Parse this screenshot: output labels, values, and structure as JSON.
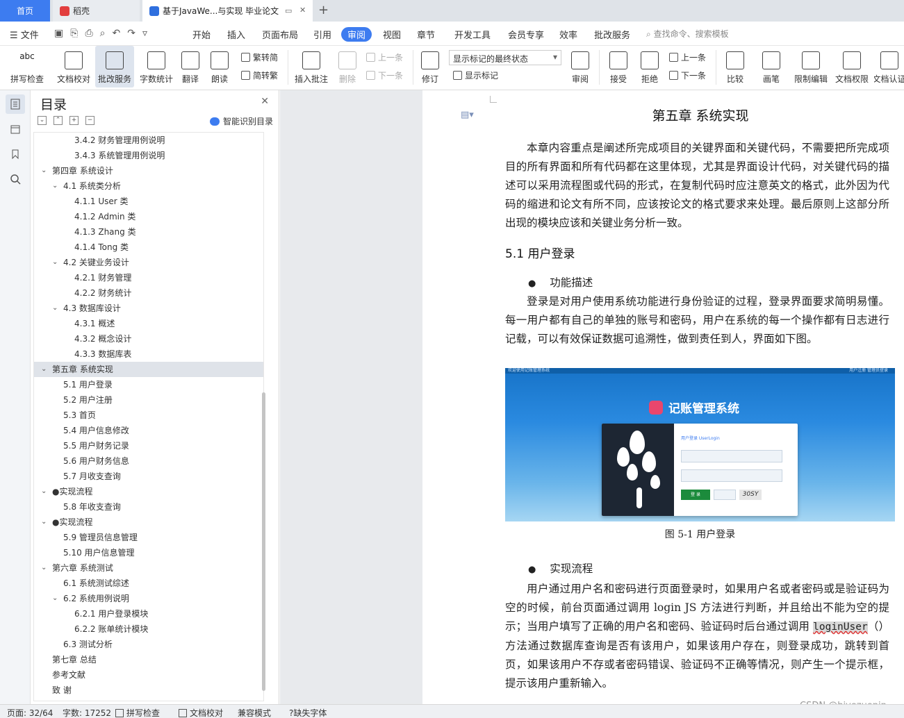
{
  "tabs": [
    {
      "label": "首页"
    },
    {
      "label": "稻壳"
    },
    {
      "label": "基于JavaWe...与实现 毕业论文"
    }
  ],
  "menu": {
    "file": "文件",
    "items": [
      "开始",
      "插入",
      "页面布局",
      "引用",
      "审阅",
      "视图",
      "章节",
      "开发工具",
      "会员专享",
      "效率",
      "批改服务"
    ],
    "active": "审阅",
    "search_placeholder": "查找命令、搜索模板"
  },
  "ribbon": {
    "spellcheck": "拼写检查",
    "doc_proof": "文档校对",
    "review_service": "批改服务",
    "word_count": "字数统计",
    "translate": "翻译",
    "read_aloud": "朗读",
    "trad_to_simp": "繁转简",
    "simp_to_trad": "简转繁",
    "insert_comment": "插入批注",
    "delete": "删除",
    "prev_comment": "上一条",
    "next_comment": "下一条",
    "track_changes": "修订",
    "markup_select": "显示标记的最终状态",
    "show_markup": "显示标记",
    "review_pane": "审阅",
    "accept": "接受",
    "reject": "拒绝",
    "prev_change": "上一条",
    "next_change": "下一条",
    "compare": "比较",
    "ink": "画笔",
    "restrict_edit": "限制编辑",
    "doc_permission": "文档权限",
    "doc_cert": "文档认证"
  },
  "toc": {
    "title": "目录",
    "smart_button": "智能识别目录",
    "items": [
      {
        "label": "3.4.2 财务管理用例说明",
        "level": 3,
        "caret": false
      },
      {
        "label": "3.4.3 系统管理用例说明",
        "level": 3,
        "caret": false
      },
      {
        "label": "第四章    系统设计",
        "level": 1,
        "caret": true
      },
      {
        "label": "4.1 系统类分析",
        "level": 2,
        "caret": true
      },
      {
        "label": "4.1.1 User 类",
        "level": 3,
        "caret": false
      },
      {
        "label": "4.1.2 Admin 类",
        "level": 3,
        "caret": false
      },
      {
        "label": "4.1.3 Zhang 类",
        "level": 3,
        "caret": false
      },
      {
        "label": "4.1.4 Tong 类",
        "level": 3,
        "caret": false
      },
      {
        "label": "4.2 关键业务设计",
        "level": 2,
        "caret": true
      },
      {
        "label": "4.2.1  财务管理",
        "level": 3,
        "caret": false
      },
      {
        "label": "4.2.2  财务统计",
        "level": 3,
        "caret": false
      },
      {
        "label": "4.3 数据库设计",
        "level": 2,
        "caret": true
      },
      {
        "label": "4.3.1 概述",
        "level": 3,
        "caret": false
      },
      {
        "label": "4.3.2 概念设计",
        "level": 3,
        "caret": false
      },
      {
        "label": "4.3.3 数据库表",
        "level": 3,
        "caret": false
      },
      {
        "label": "第五章  系统实现",
        "level": 1,
        "caret": true,
        "selected": true
      },
      {
        "label": "5.1 用户登录",
        "level": 2,
        "caret": false
      },
      {
        "label": "5.2  用户注册",
        "level": 2,
        "caret": false
      },
      {
        "label": "5.3  首页",
        "level": 2,
        "caret": false
      },
      {
        "label": "5.4    用户信息修改",
        "level": 2,
        "caret": false
      },
      {
        "label": "5.5    用户财务记录",
        "level": 2,
        "caret": false
      },
      {
        "label": "5.6    用户财务信息",
        "level": 2,
        "caret": false
      },
      {
        "label": "5.7    月收支查询",
        "level": 2,
        "caret": false
      },
      {
        "label": "●实现流程",
        "level": 1,
        "caret": true
      },
      {
        "label": "5.8  年收支查询",
        "level": 2,
        "caret": false
      },
      {
        "label": "●实现流程",
        "level": 1,
        "caret": true
      },
      {
        "label": "5.9  管理员信息管理",
        "level": 2,
        "caret": false
      },
      {
        "label": "5.10  用户信息管理",
        "level": 2,
        "caret": false
      },
      {
        "label": "第六章    系统测试",
        "level": 1,
        "caret": true
      },
      {
        "label": "6.1 系统测试综述",
        "level": 2,
        "caret": false
      },
      {
        "label": "6.2 系统用例说明",
        "level": 2,
        "caret": true
      },
      {
        "label": "6.2.1 用户登录模块",
        "level": 3,
        "caret": false
      },
      {
        "label": "6.2.2 账单统计模块",
        "level": 3,
        "caret": false
      },
      {
        "label": "6.3 测试分析",
        "level": 2,
        "caret": false
      },
      {
        "label": "第七章    总结",
        "level": 1,
        "caret": false
      },
      {
        "label": "参考文献",
        "level": 1,
        "caret": false
      },
      {
        "label": "致    谢",
        "level": 1,
        "caret": false
      }
    ]
  },
  "document": {
    "chapter_title": "第五章  系统实现",
    "intro": "本章内容重点是阐述所完成项目的关键界面和关键代码，不需要把所完成项目的所有界面和所有代码都在这里体现，尤其是界面设计代码，对关键代码的描述可以采用流程图或代码的形式，在复制代码时应注意英文的格式，此外因为代码的缩进和论文有所不同，应该按论文的格式要求来处理。最后原则上这部分所出现的模块应该和关键业务分析一致。",
    "section_title": "5.1 用户登录",
    "bullet_1": "功能描述",
    "para_1": "登录是对用户使用系统功能进行身份验证的过程，登录界面要求简明易懂。每一用户都有自己的单独的账号和密码，用户在系统的每一个操作都有日志进行记载，可以有效保证数据可追溯性，做到责任到人，界面如下图。",
    "figure": {
      "top_left": "欢迎使用记账管理系统",
      "top_right": "用户注册    管理员登录",
      "app_title": "记账管理系统",
      "form_header": "用户登录  UserLogin",
      "login_button": "登  录",
      "captcha": "30SY",
      "caption": "图 5-1  用户登录"
    },
    "bullet_2": "实现流程",
    "para_2_a": "用户通过用户名和密码进行页面登录时，如果用户名或者密码或是验证码为空的时候，前台页面通过调用 login JS 方法进行判断，并且给出不能为空的提示；当用户填写了正确的用户名和密码、验证码时后台通过调用 ",
    "para_2_code": "loginUser",
    "para_2_b": "（）方法通过数据库查询是否有该用户，如果该用户存在，则登录成功，跳转到首页，如果该用户不存或者密码错误、验证码不正确等情况，则产生一个提示框，提示该用户重新输入。"
  },
  "statusbar": {
    "page": "页面: 32/64",
    "words": "字数: 17252",
    "spellcheck": "拼写检查",
    "proof": "文档校对",
    "compat": "兼容模式",
    "missing_font": "缺失字体"
  },
  "watermark": "CSDN @biyezuopin",
  "colors": {
    "accent": "#3d7cf0",
    "toc_selected": "#dfe3e9",
    "login_green": "#1c8b3c"
  }
}
